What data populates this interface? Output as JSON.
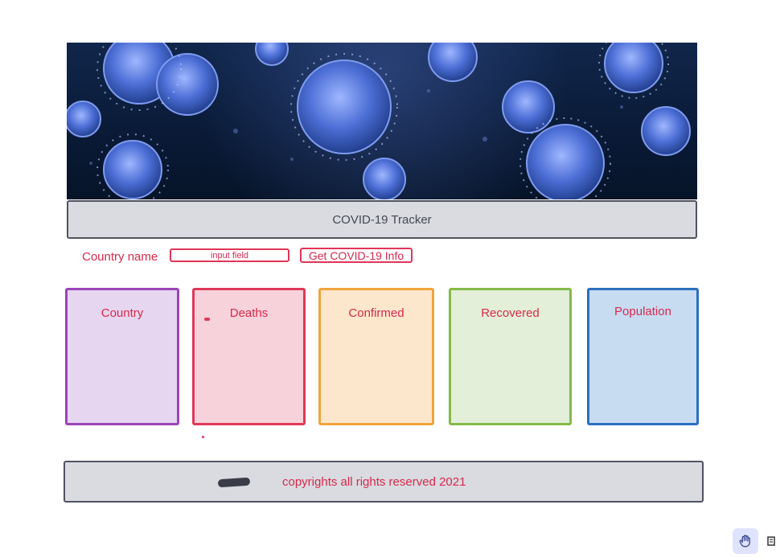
{
  "header": {
    "title": "COVID-19 Tracker"
  },
  "search": {
    "label": "Country name",
    "input_placeholder": "input field",
    "button_label": "Get COVID-19 Info"
  },
  "cards": [
    {
      "label": "Country"
    },
    {
      "label": "Deaths"
    },
    {
      "label": "Confirmed"
    },
    {
      "label": "Recovered"
    },
    {
      "label": "Population"
    }
  ],
  "footer": {
    "text": "copyrights all rights reserved 2021"
  },
  "toolbar": {
    "tools": [
      "hand-icon",
      "select-icon"
    ]
  },
  "colors": {
    "accent": "#d8294c",
    "bar_bg": "#d9dbe0",
    "bar_border": "#4f5361"
  }
}
